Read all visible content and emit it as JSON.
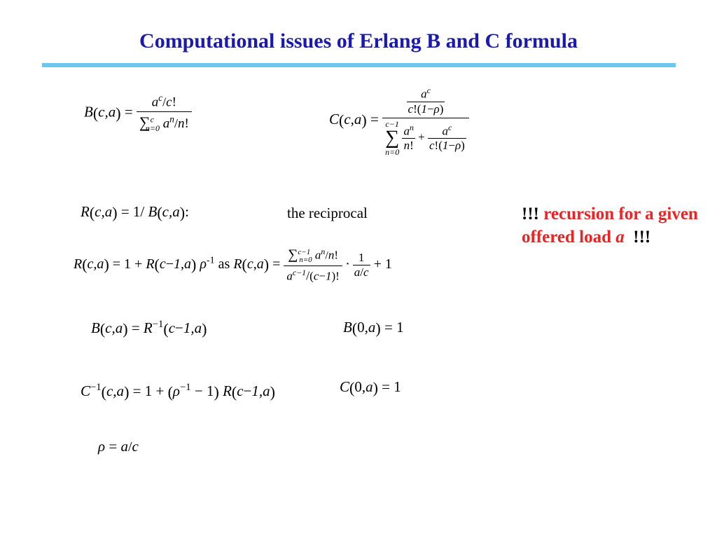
{
  "title": "Computational issues of Erlang B and C formula",
  "eq_B_lhs": "B(c,a) =",
  "eq_C_lhs": "C(c,a) =",
  "recip_def": "R(c,a) = 1 / B(c,a):",
  "recip_label": "the reciprocal",
  "recursion_R_lhs": "R(c,a) = 1 + R(c−1,a) ρ",
  "recursion_R_sup": "-1",
  "recursion_as": " as ",
  "eq_BR": "B(c,a) = R⁻¹(c−1,a)",
  "eq_B0": "B(0,a) = 1",
  "eq_Cinv": "C⁻¹(c,a) = 1 + (ρ⁻¹ − 1) R(c−1,a)",
  "eq_C0": "C(0,a) = 1",
  "eq_rho": "ρ = a / c",
  "callout_mark": "!!!",
  "callout_red1": " recursion for a given offered load ",
  "callout_ital": "a"
}
